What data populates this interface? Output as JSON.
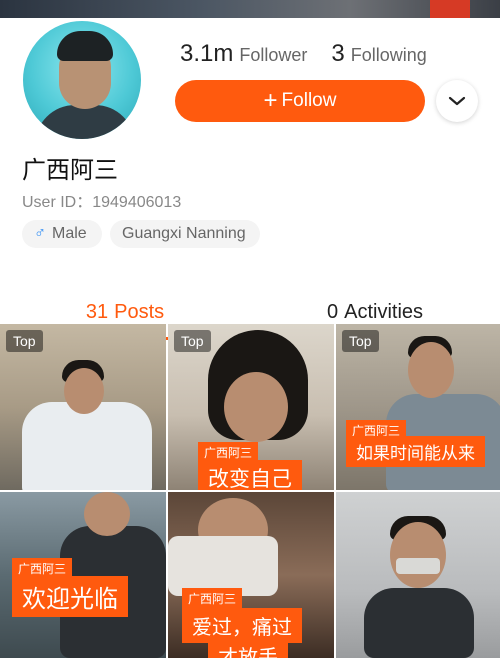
{
  "profile": {
    "followers_count": "3.1m",
    "followers_label": "Follower",
    "following_count": "3",
    "following_label": "Following",
    "follow_button_label": "Follow",
    "username": "广西阿三",
    "user_id": "User ID：1949406013",
    "gender": "Male",
    "location": "Guangxi Nanning"
  },
  "tabs": [
    {
      "count": "31",
      "label": "Posts",
      "active": true
    },
    {
      "count": "0",
      "label": "Activities",
      "active": false
    }
  ],
  "posts": [
    {
      "badge": "Top",
      "caption_small": "",
      "caption_big": ""
    },
    {
      "badge": "Top",
      "caption_small": "广西阿三",
      "caption_big": "改变自己"
    },
    {
      "badge": "Top",
      "caption_small": "广西阿三",
      "caption_big": "如果时间能从来"
    },
    {
      "badge": "",
      "caption_small": "广西阿三",
      "caption_big": "欢迎光临"
    },
    {
      "badge": "",
      "caption_small": "广西阿三",
      "caption_big": "爱过，痛过",
      "caption_big2": "才放手"
    },
    {
      "badge": "",
      "caption_small": "",
      "caption_big": ""
    }
  ],
  "colors": {
    "accent": "#ff5a0e",
    "tag_bg": "#f4f4f4",
    "male_icon": "#2f8df4"
  },
  "icons": {
    "more": "chevron-down-icon",
    "gender": "male-icon",
    "follow": "plus-icon"
  }
}
